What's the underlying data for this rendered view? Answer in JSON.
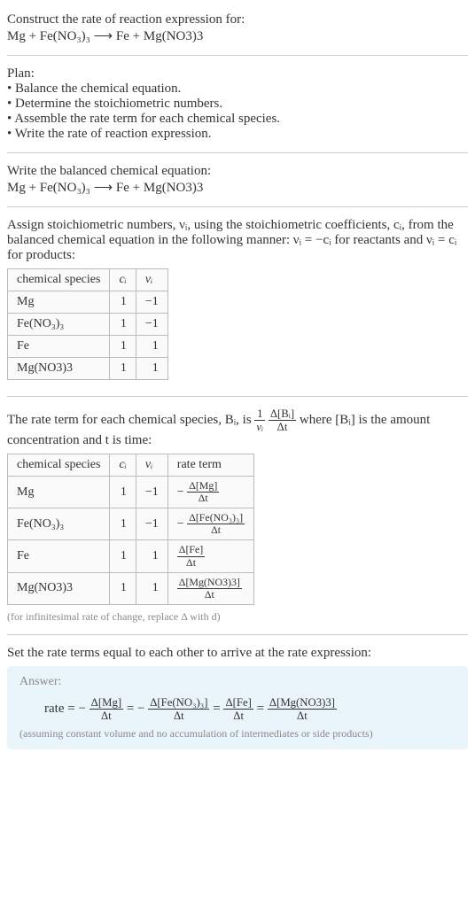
{
  "intro": {
    "title": "Construct the rate of reaction expression for:",
    "equation": "Mg + Fe(NO₃)₃  ⟶  Fe + Mg(NO3)3"
  },
  "plan": {
    "heading": "Plan:",
    "items": [
      "Balance the chemical equation.",
      "Determine the stoichiometric numbers.",
      "Assemble the rate term for each chemical species.",
      "Write the rate of reaction expression."
    ]
  },
  "balanced": {
    "heading": "Write the balanced chemical equation:",
    "equation": "Mg + Fe(NO₃)₃  ⟶  Fe + Mg(NO3)3"
  },
  "stoich_intro": "Assign stoichiometric numbers, νᵢ, using the stoichiometric coefficients, cᵢ, from the balanced chemical equation in the following manner: νᵢ = −cᵢ for reactants and νᵢ = cᵢ for products:",
  "stoich_table": {
    "headers": [
      "chemical species",
      "cᵢ",
      "νᵢ"
    ],
    "rows": [
      {
        "species": "Mg",
        "c": "1",
        "v": "−1"
      },
      {
        "species": "Fe(NO₃)₃",
        "c": "1",
        "v": "−1"
      },
      {
        "species": "Fe",
        "c": "1",
        "v": "1"
      },
      {
        "species": "Mg(NO3)3",
        "c": "1",
        "v": "1"
      }
    ]
  },
  "rate_intro_pre": "The rate term for each chemical species, Bᵢ, is ",
  "rate_intro_post": " where [Bᵢ] is the amount concentration and t is time:",
  "rate_frac": {
    "num": "1",
    "den": "νᵢ"
  },
  "rate_frac2": {
    "num": "Δ[Bᵢ]",
    "den": "Δt"
  },
  "rate_table": {
    "headers": [
      "chemical species",
      "cᵢ",
      "νᵢ",
      "rate term"
    ],
    "rows": [
      {
        "species": "Mg",
        "c": "1",
        "v": "−1",
        "term_num": "Δ[Mg]",
        "term_den": "Δt",
        "neg": "− "
      },
      {
        "species": "Fe(NO₃)₃",
        "c": "1",
        "v": "−1",
        "term_num": "Δ[Fe(NO₃)₃]",
        "term_den": "Δt",
        "neg": "− "
      },
      {
        "species": "Fe",
        "c": "1",
        "v": "1",
        "term_num": "Δ[Fe]",
        "term_den": "Δt",
        "neg": ""
      },
      {
        "species": "Mg(NO3)3",
        "c": "1",
        "v": "1",
        "term_num": "Δ[Mg(NO3)3]",
        "term_den": "Δt",
        "neg": ""
      }
    ]
  },
  "inf_note": "(for infinitesimal rate of change, replace Δ with d)",
  "final_heading": "Set the rate terms equal to each other to arrive at the rate expression:",
  "answer": {
    "label": "Answer:",
    "prefix": "rate = − ",
    "t1": {
      "num": "Δ[Mg]",
      "den": "Δt"
    },
    "eq1": " = − ",
    "t2": {
      "num": "Δ[Fe(NO₃)₃]",
      "den": "Δt"
    },
    "eq2": " = ",
    "t3": {
      "num": "Δ[Fe]",
      "den": "Δt"
    },
    "eq3": " = ",
    "t4": {
      "num": "Δ[Mg(NO3)3]",
      "den": "Δt"
    },
    "note": "(assuming constant volume and no accumulation of intermediates or side products)"
  }
}
